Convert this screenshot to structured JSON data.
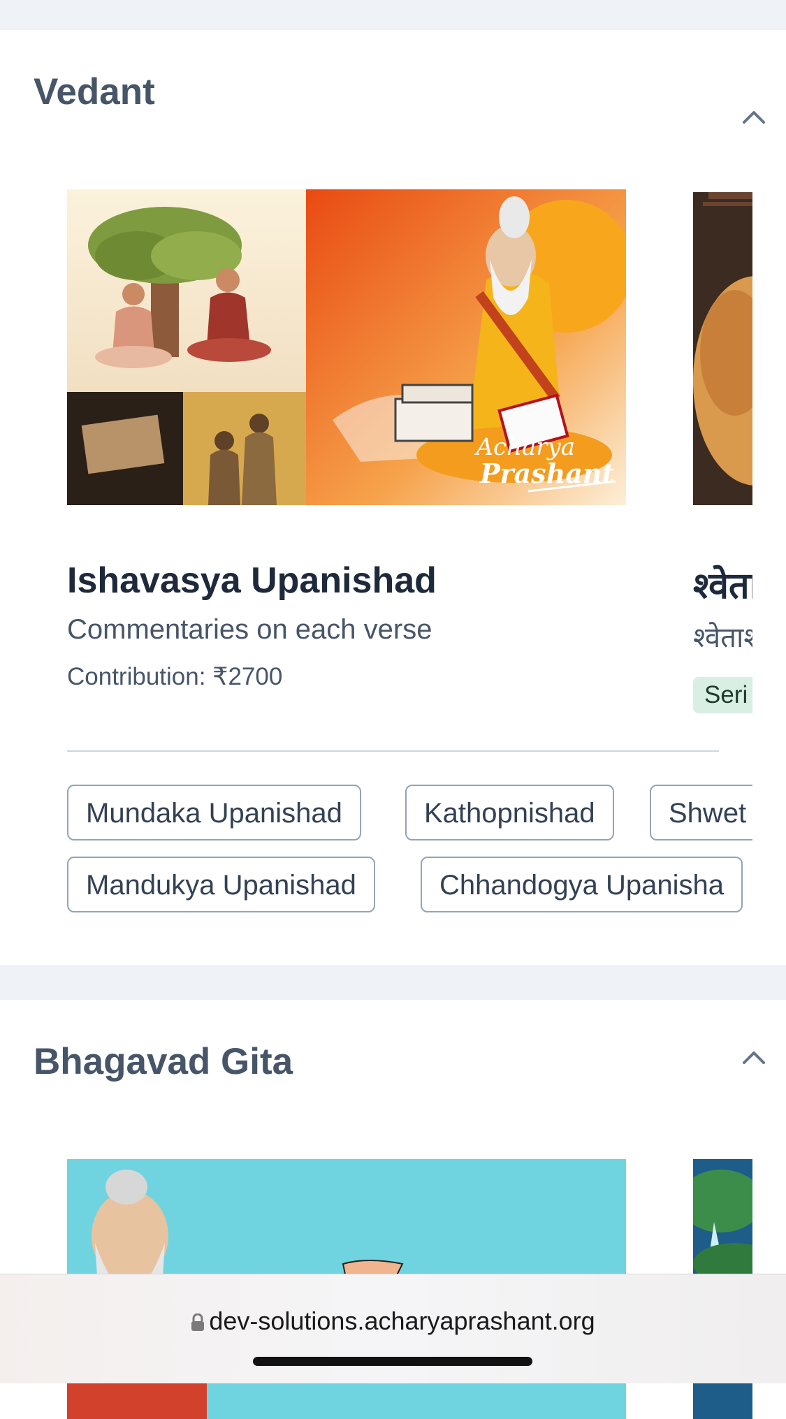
{
  "sections": [
    {
      "title": "Vedant",
      "cards": [
        {
          "title": "Ishavasya Upanishad",
          "subtitle": "Commentaries on each verse",
          "price": "Contribution: ₹2700",
          "watermark_line1": "Acharya",
          "watermark_line2": "Prashant"
        },
        {
          "title": "श्वेता",
          "subtitle": "श्वेताश्व",
          "badge": "Seri"
        }
      ],
      "chips": [
        "Mundaka Upanishad",
        "Kathopnishad",
        "Shwet",
        "Mandukya Upanishad",
        "Chhandogya Upanisha"
      ]
    },
    {
      "title": "Bhagavad Gita"
    }
  ],
  "browser": {
    "url": "dev-solutions.acharyaprashant.org"
  },
  "icons": {
    "collapse": "chevron-up-icon",
    "lock": "lock-icon"
  },
  "colors": {
    "heading": "#475569",
    "badge_bg": "#d9efe3",
    "chip_border": "#94a3b8",
    "page_bg": "#eff2f7"
  }
}
